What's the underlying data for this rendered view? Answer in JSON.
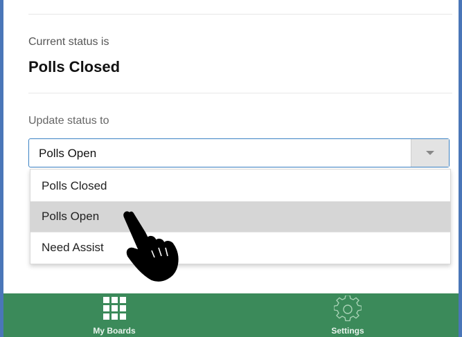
{
  "status": {
    "current_label": "Current status is",
    "current_value": "Polls Closed",
    "update_label": "Update status to"
  },
  "select": {
    "value": "Polls Open",
    "options": [
      "Polls Closed",
      "Polls Open",
      "Need Assist"
    ],
    "highlighted_option": "Polls Open"
  },
  "bottom_nav": {
    "tabs": [
      {
        "label": "My Boards",
        "icon": "grid-icon"
      },
      {
        "label": "Settings",
        "icon": "gear-icon"
      }
    ]
  },
  "colors": {
    "frame_border": "#4a76b8",
    "select_border": "#3b82c4",
    "bottom_bar": "#3b8a5a",
    "selected_option_bg": "#d6d6d6"
  },
  "cursor": {
    "icon": "pointing-hand-cursor"
  }
}
